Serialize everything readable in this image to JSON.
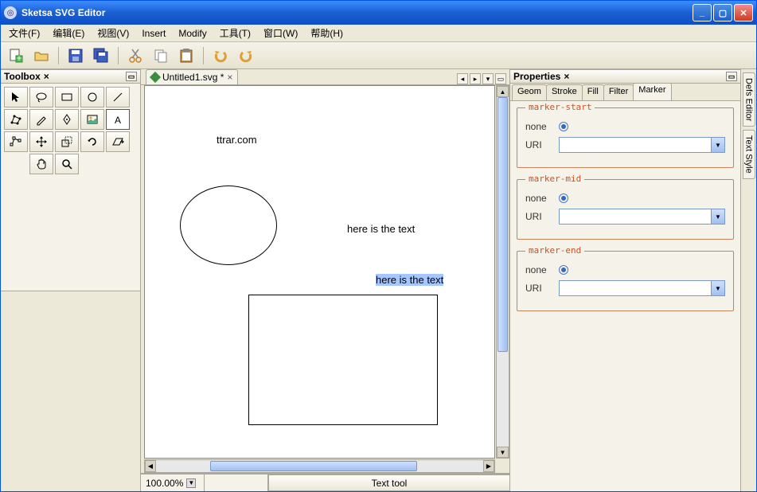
{
  "title": "Sketsa SVG Editor",
  "menu": {
    "file": "文件(F)",
    "edit": "编辑(E)",
    "view": "视图(V)",
    "insert": "Insert",
    "modify": "Modify",
    "tools": "工具(T)",
    "window": "窗口(W)",
    "help": "帮助(H)"
  },
  "toolbox": {
    "title": "Toolbox"
  },
  "doc": {
    "tab_label": "Untitled1.svg *",
    "text1": "ttrar.com",
    "text2": "here is the text",
    "text3": "here is the text"
  },
  "status": {
    "zoom": "100.00%",
    "tool": "Text tool"
  },
  "properties": {
    "title": "Properties",
    "tabs": {
      "geom": "Geom",
      "stroke": "Stroke",
      "fill": "Fill",
      "filter": "Filter",
      "marker": "Marker"
    },
    "marker": {
      "start": {
        "legend": "marker-start",
        "none": "none",
        "uri": "URI",
        "value": ""
      },
      "mid": {
        "legend": "marker-mid",
        "none": "none",
        "uri": "URI",
        "value": ""
      },
      "end": {
        "legend": "marker-end",
        "none": "none",
        "uri": "URI",
        "value": ""
      }
    }
  },
  "side": {
    "defs": "Defs Editor",
    "text_style": "Text Style"
  }
}
